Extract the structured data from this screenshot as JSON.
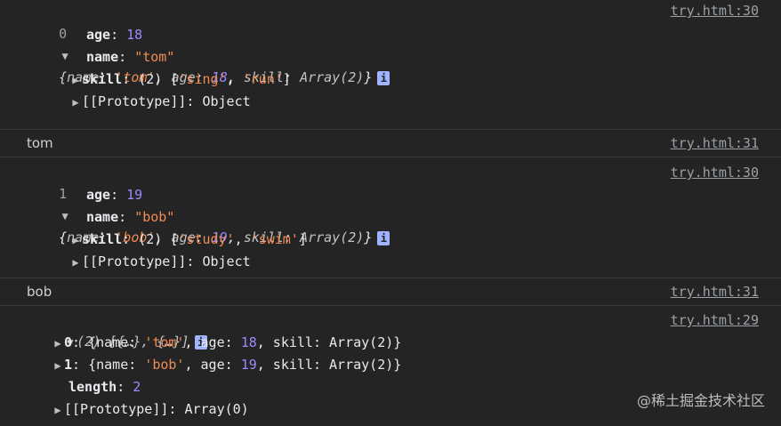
{
  "entries": [
    {
      "index": "0",
      "header": {
        "name_key": "name",
        "name_val": "'tom'",
        "age_key": "age",
        "age_val": "18",
        "skill_key": "skill",
        "skill_val": "Array(2)"
      },
      "age": {
        "key": "age",
        "val": "18"
      },
      "name": {
        "key": "name",
        "val": "\"tom\""
      },
      "skill": {
        "key": "skill",
        "count": "(2)",
        "items": [
          "'sing'",
          "'run'"
        ]
      },
      "proto": {
        "key": "[[Prototype]]",
        "val": "Object"
      },
      "source": "try.html:30"
    },
    {
      "index": "1",
      "header": {
        "name_key": "name",
        "name_val": "'bob'",
        "age_key": "age",
        "age_val": "19",
        "skill_key": "skill",
        "skill_val": "Array(2)"
      },
      "age": {
        "key": "age",
        "val": "19"
      },
      "name": {
        "key": "name",
        "val": "\"bob\""
      },
      "skill": {
        "key": "skill",
        "count": "(2)",
        "items": [
          "'study'",
          "'swim'"
        ]
      },
      "proto": {
        "key": "[[Prototype]]",
        "val": "Object"
      },
      "source": "try.html:30"
    }
  ],
  "logs": [
    {
      "text": "tom",
      "source": "try.html:31"
    },
    {
      "text": "bob",
      "source": "try.html:31"
    }
  ],
  "array": {
    "header": "(2) [{…}, {…}]",
    "source": "try.html:29",
    "item0": {
      "idx": "0",
      "name_val": "'tom'",
      "age_val": "18",
      "skill_val": "Array(2)"
    },
    "item1": {
      "idx": "1",
      "name_val": "'bob'",
      "age_val": "19",
      "skill_val": "Array(2)"
    },
    "length": {
      "key": "length",
      "val": "2"
    },
    "proto": {
      "key": "[[Prototype]]",
      "val": "Array(0)"
    }
  },
  "info_glyph": "i",
  "watermark": "@稀土掘金技术社区"
}
